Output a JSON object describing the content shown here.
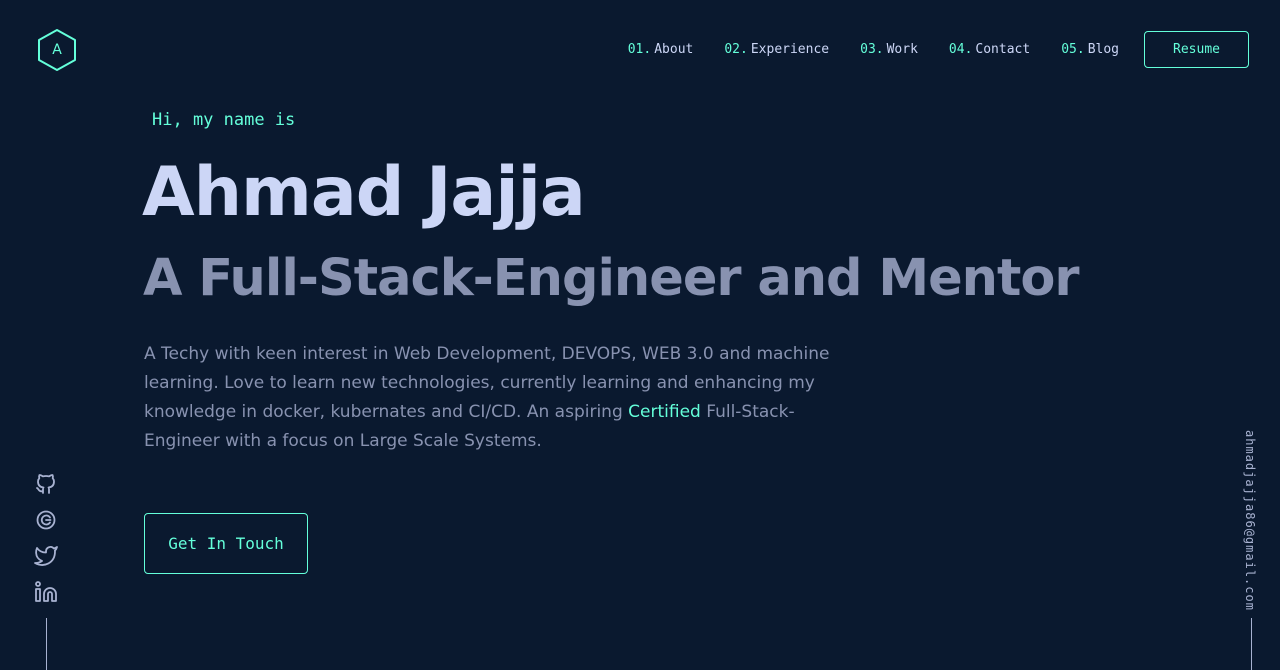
{
  "brand": {
    "logo_letter": "A",
    "accent_color": "#64ffda",
    "background_color": "#0a192f"
  },
  "nav": {
    "items": [
      {
        "num": "01.",
        "label": "About"
      },
      {
        "num": "02.",
        "label": "Experience"
      },
      {
        "num": "03.",
        "label": "Work"
      },
      {
        "num": "04.",
        "label": "Contact"
      },
      {
        "num": "05.",
        "label": "Blog"
      }
    ],
    "resume_label": "Resume"
  },
  "hero": {
    "greeting": "Hi, my name is",
    "name": "Ahmad Jajja",
    "tagline": "A Full-Stack-Engineer and Mentor",
    "bio_before": "A Techy with keen interest in Web Development, DEVOPS, WEB 3.0 and machine learning. Love to learn new technologies, currently learning and enhancing my knowledge in docker, kubernates and CI/CD. An aspiring ",
    "bio_highlight": "Certified",
    "bio_after": " Full-Stack-Engineer with a focus on Large Scale Systems.",
    "cta_label": "Get In Touch"
  },
  "social": {
    "icons": [
      "github-icon",
      "codepen-icon",
      "twitter-icon",
      "linkedin-icon"
    ]
  },
  "contact": {
    "email": "ahmadjajja86@gmail.com"
  }
}
